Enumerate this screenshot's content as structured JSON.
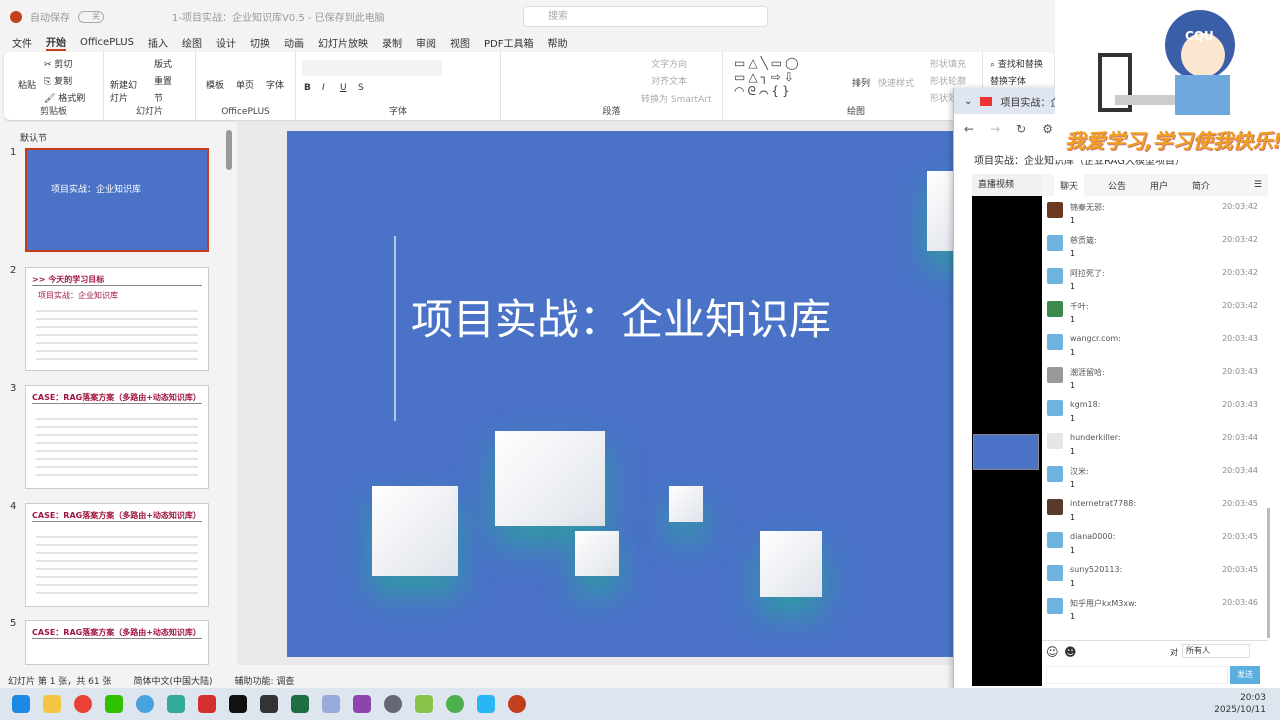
{
  "titlebar": {
    "autosave": "自动保存",
    "autosave_state": "关",
    "doc_title": "1-项目实战：企业知识库V0.5 - 已保存到此电脑",
    "search_placeholder": "搜索"
  },
  "menu": [
    "文件",
    "开始",
    "OfficePLUS",
    "插入",
    "绘图",
    "设计",
    "切换",
    "动画",
    "幻灯片放映",
    "录制",
    "审阅",
    "视图",
    "PDF工具箱",
    "帮助"
  ],
  "ribbon": {
    "clipboard": {
      "label": "剪贴板",
      "paste": "粘贴",
      "cut": "剪切",
      "copy": "复制",
      "format_painter": "格式刷"
    },
    "slides": {
      "label": "幻灯片",
      "new_slide": "新建幻灯片",
      "layout": "版式",
      "reset": "重置",
      "section": "节"
    },
    "officeplus": {
      "label": "OfficePLUS",
      "template": "模板",
      "single": "单页",
      "font": "字体"
    },
    "font": {
      "label": "字体",
      "bold": "B",
      "italic": "I",
      "underline": "U",
      "strike": "S"
    },
    "paragraph": {
      "label": "段落",
      "text_direction": "文字方向",
      "align_text": "对齐文本",
      "smartart": "转换为 SmartArt"
    },
    "drawing": {
      "label": "绘图",
      "arrange": "排列",
      "quick_styles": "快速样式",
      "shape_fill": "形状填充",
      "shape_outline": "形状轮廓",
      "shape_effects": "形状效果"
    },
    "editing": {
      "find_replace": "查找和替换",
      "replace_font": "替换字体"
    }
  },
  "thumbnails": {
    "section": "默认节",
    "slides": [
      {
        "num": "1",
        "title": "项目实战：企业知识库"
      },
      {
        "num": "2",
        "title": ">> 今天的学习目标",
        "subtitle": "项目实战：企业知识库"
      },
      {
        "num": "3",
        "title": "CASE：RAG落案方案（多路由+动态知识库）"
      },
      {
        "num": "4",
        "title": "CASE：RAG落案方案（多路由+动态知识库）"
      },
      {
        "num": "5",
        "title": "CASE：RAG落案方案（多路由+动态知识库）"
      }
    ]
  },
  "slide": {
    "title": "项目实战：企业知识库"
  },
  "status": {
    "slide_count": "幻灯片 第 1 张，共 61 张",
    "language": "简体中文(中国大陆)",
    "accessibility": "辅助功能: 调查"
  },
  "browser": {
    "tab_title": "项目实战：企业",
    "page_title": "项目实战：企业知识库（企业RAG大模型项目）",
    "video_tab": "直播视频",
    "chat_tabs": [
      "聊天",
      "公告",
      "用户",
      "简介"
    ],
    "messages": [
      {
        "user": "锦秦无邪:",
        "text": "1",
        "time": "20:03:42",
        "color": "#6b3a20"
      },
      {
        "user": "慈贡箴:",
        "text": "1",
        "time": "20:03:42",
        "color": "#6cb3e0"
      },
      {
        "user": "阿拉死了:",
        "text": "1",
        "time": "20:03:42",
        "color": "#6cb3e0"
      },
      {
        "user": "千叶:",
        "text": "1",
        "time": "20:03:42",
        "color": "#3a8a4a"
      },
      {
        "user": "wangcr.com:",
        "text": "1",
        "time": "20:03:43",
        "color": "#6cb3e0"
      },
      {
        "user": "潮涯留哈:",
        "text": "1",
        "time": "20:03:43",
        "color": "#999999"
      },
      {
        "user": "kgm18:",
        "text": "1",
        "time": "20:03:43",
        "color": "#6cb3e0"
      },
      {
        "user": "hunderkiller:",
        "text": "1",
        "time": "20:03:44",
        "color": "#e6e6e6"
      },
      {
        "user": "汉米:",
        "text": "1",
        "time": "20:03:44",
        "color": "#6cb3e0"
      },
      {
        "user": "internetrat7788:",
        "text": "1",
        "time": "20:03:45",
        "color": "#5a3a2a"
      },
      {
        "user": "diana0000:",
        "text": "1",
        "time": "20:03:45",
        "color": "#6cb3e0"
      },
      {
        "user": "suny520113:",
        "text": "1",
        "time": "20:03:45",
        "color": "#6cb3e0"
      },
      {
        "user": "知乎用户kxM3xw:",
        "text": "1",
        "time": "20:03:46",
        "color": "#6cb3e0"
      }
    ],
    "to_label": "对",
    "recipient": "所有人",
    "send": "发送"
  },
  "webcam": {
    "badge": "CQU",
    "motto": "我爱学习,学习使我快乐!"
  },
  "tray": {
    "time": "20:03",
    "date": "2025/10/11"
  },
  "colors": {
    "slide_bg": "#4a73c8",
    "accent": "#c43e1c"
  }
}
